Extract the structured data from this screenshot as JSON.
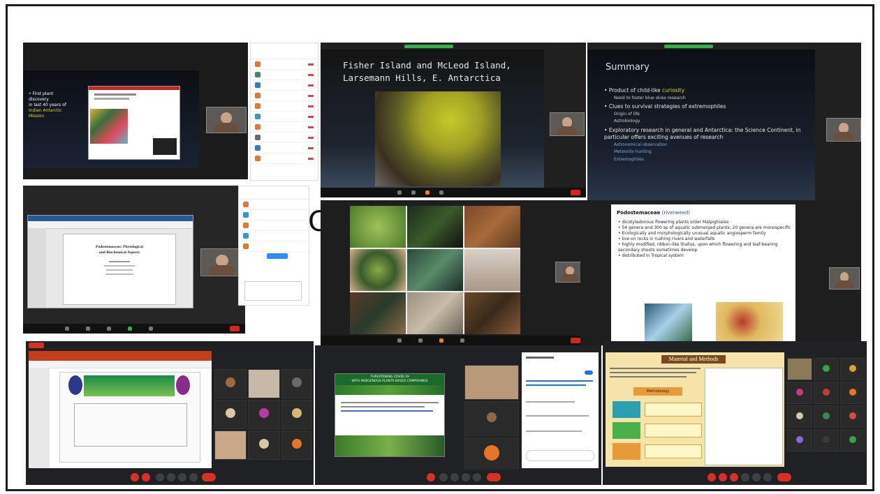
{
  "tile1": {
    "bullet_lead": "First plant discovery",
    "bullet_lines": [
      "in last 40 years of"
    ],
    "bullet_yellow": [
      "Indian Antarctic",
      "Mission"
    ]
  },
  "tile2": {
    "title_line1": "Fisher Island and McLeod Island,",
    "title_line2": "Larsemann Hills, E. Antarctica"
  },
  "tile3": {
    "title": "Summary",
    "b1_lead": "Product of child-like ",
    "b1_yellow": "curiosity",
    "b1_sub": "Need to foster blue skies research",
    "b2": "Clues to survival strategies of extremophiles",
    "b2_subs": [
      "Origin of life",
      "Astrobiology"
    ],
    "b3": "Exploratory research in general and Antarctica: the Science Continent, in particular offers exciting avenues of research",
    "b3_subs": [
      "Astronomical observation",
      "Meteorite hunting",
      "Extremophiles"
    ]
  },
  "tile4": {
    "doc_title_line1": "Podostemaceae: Phytological",
    "doc_title_line2": "and Biochemical Aspects"
  },
  "middle_glyph": "C",
  "tile6": {
    "heading": "Podostemaceae",
    "heading_suffix": " (riverweed)",
    "bullets": [
      "dicotyledonous flowering plants order Malpighiales",
      "54 genera and 300 sp of aquatic submerged plants; 20 genera are monospecific",
      "Ecologically and morphologically unusual aquatic angiosperm family",
      "live on rocks in rushing rivers and waterfalls",
      "highly modified, ribbon-like thallus, upon which flowering and leaf-bearing secondary shoots sometimes develop",
      "distributed in Tropical system"
    ]
  },
  "tile8": {
    "poster_title_line1": "THREATENING COVID-19",
    "poster_title_line2": "WITH INDIGENOUS PLANTS BASED COMPOUNDS"
  },
  "tile9": {
    "banner": "Material and Methods",
    "stage_labels": [
      "Methodology"
    ]
  },
  "colors": {
    "accent_green": "#2fb34a",
    "end_red": "#d2261f",
    "slide_yellow": "#e8d82a",
    "slide_blue": "#7fa8e8"
  }
}
